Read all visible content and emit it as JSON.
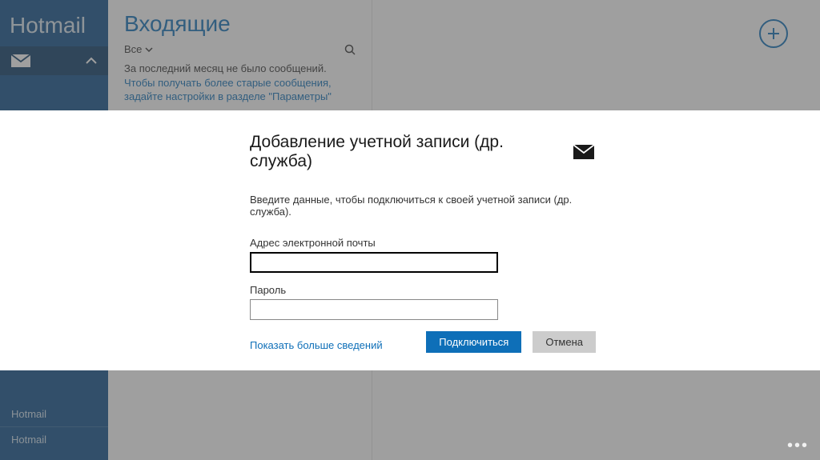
{
  "sidebar": {
    "title": "Hotmail",
    "accounts": [
      "Hotmail",
      "Hotmail"
    ]
  },
  "inbox": {
    "title": "Входящие",
    "filter_label": "Все",
    "empty_prefix": "За последний месяц не было сообщений. ",
    "empty_link": "Чтобы получать более старые сообщения, задайте настройки в разделе \"Параметры\""
  },
  "dialog": {
    "title": "Добавление учетной записи (др. служба)",
    "instructions": "Введите данные, чтобы подключиться к своей учетной записи (др. служба).",
    "email_label": "Адрес электронной почты",
    "email_value": "",
    "password_label": "Пароль",
    "password_value": "",
    "show_more": "Показать больше сведений",
    "connect_label": "Подключиться",
    "cancel_label": "Отмена"
  }
}
